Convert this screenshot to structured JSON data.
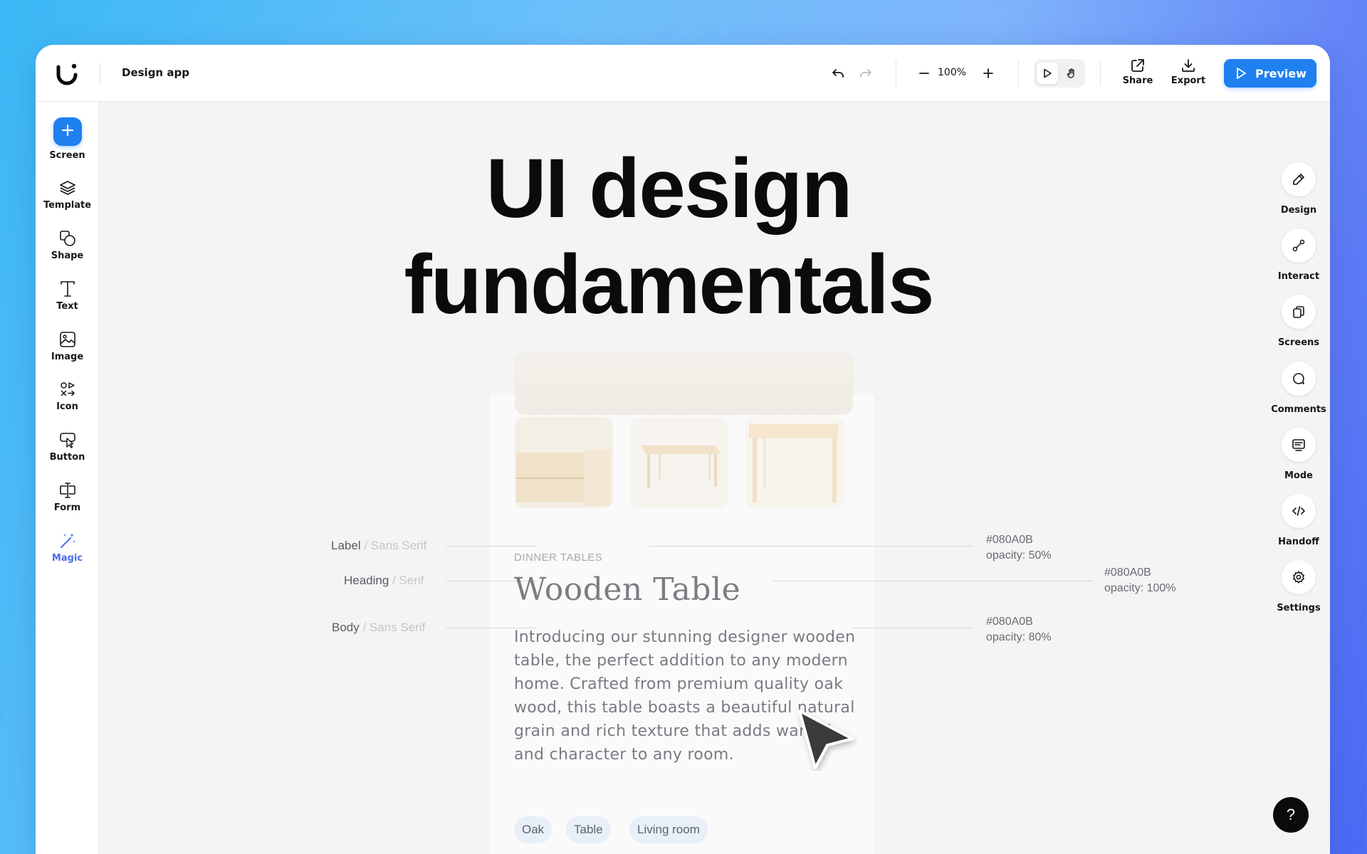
{
  "topbar": {
    "app_title": "Design app",
    "zoom": "100%",
    "share_label": "Share",
    "export_label": "Export",
    "preview_label": "Preview"
  },
  "left_sidebar": {
    "items": [
      {
        "label": "Screen",
        "icon": "plus-icon"
      },
      {
        "label": "Template",
        "icon": "layers-icon"
      },
      {
        "label": "Shape",
        "icon": "shapes-icon"
      },
      {
        "label": "Text",
        "icon": "text-icon"
      },
      {
        "label": "Image",
        "icon": "image-icon"
      },
      {
        "label": "Icon",
        "icon": "icons-icon"
      },
      {
        "label": "Button",
        "icon": "button-icon"
      },
      {
        "label": "Form",
        "icon": "form-icon"
      },
      {
        "label": "Magic",
        "icon": "magic-wand-icon"
      }
    ]
  },
  "right_panel": {
    "items": [
      {
        "label": "Design",
        "icon": "pencil-icon"
      },
      {
        "label": "Interact",
        "icon": "interact-icon"
      },
      {
        "label": "Screens",
        "icon": "screens-icon"
      },
      {
        "label": "Comments",
        "icon": "comment-icon"
      },
      {
        "label": "Mode",
        "icon": "mode-icon"
      },
      {
        "label": "Handoff",
        "icon": "code-icon"
      },
      {
        "label": "Settings",
        "icon": "gear-icon"
      }
    ],
    "help": "?"
  },
  "canvas": {
    "title_line1": "UI design",
    "title_line2": "fundamentals",
    "specs": {
      "label": {
        "name": "Label",
        "sep": " / ",
        "font": "Sans Serif",
        "color": "#080A0B",
        "opacity": "opacity: 50%"
      },
      "heading": {
        "name": "Heading",
        "sep": " / ",
        "font": "Serif",
        "color": "#080A0B",
        "opacity": "opacity: 100%"
      },
      "body": {
        "name": "Body",
        "sep": " / ",
        "font": "Sans Serif",
        "color": "#080A0B",
        "opacity": "opacity: 80%"
      }
    },
    "sample": {
      "label": "DINNER TABLES",
      "heading": "Wooden Table",
      "body": "Introducing our stunning designer wooden table, the perfect addition to any modern home. Crafted from premium quality oak wood, this table boasts a beautiful natural grain and rich texture that adds warmth and character to any room.",
      "tags": [
        "Oak",
        "Table",
        "Living room"
      ]
    }
  },
  "colors": {
    "accent": "#1f80f0",
    "magic": "#4a6df0",
    "text": "#080A0B"
  }
}
